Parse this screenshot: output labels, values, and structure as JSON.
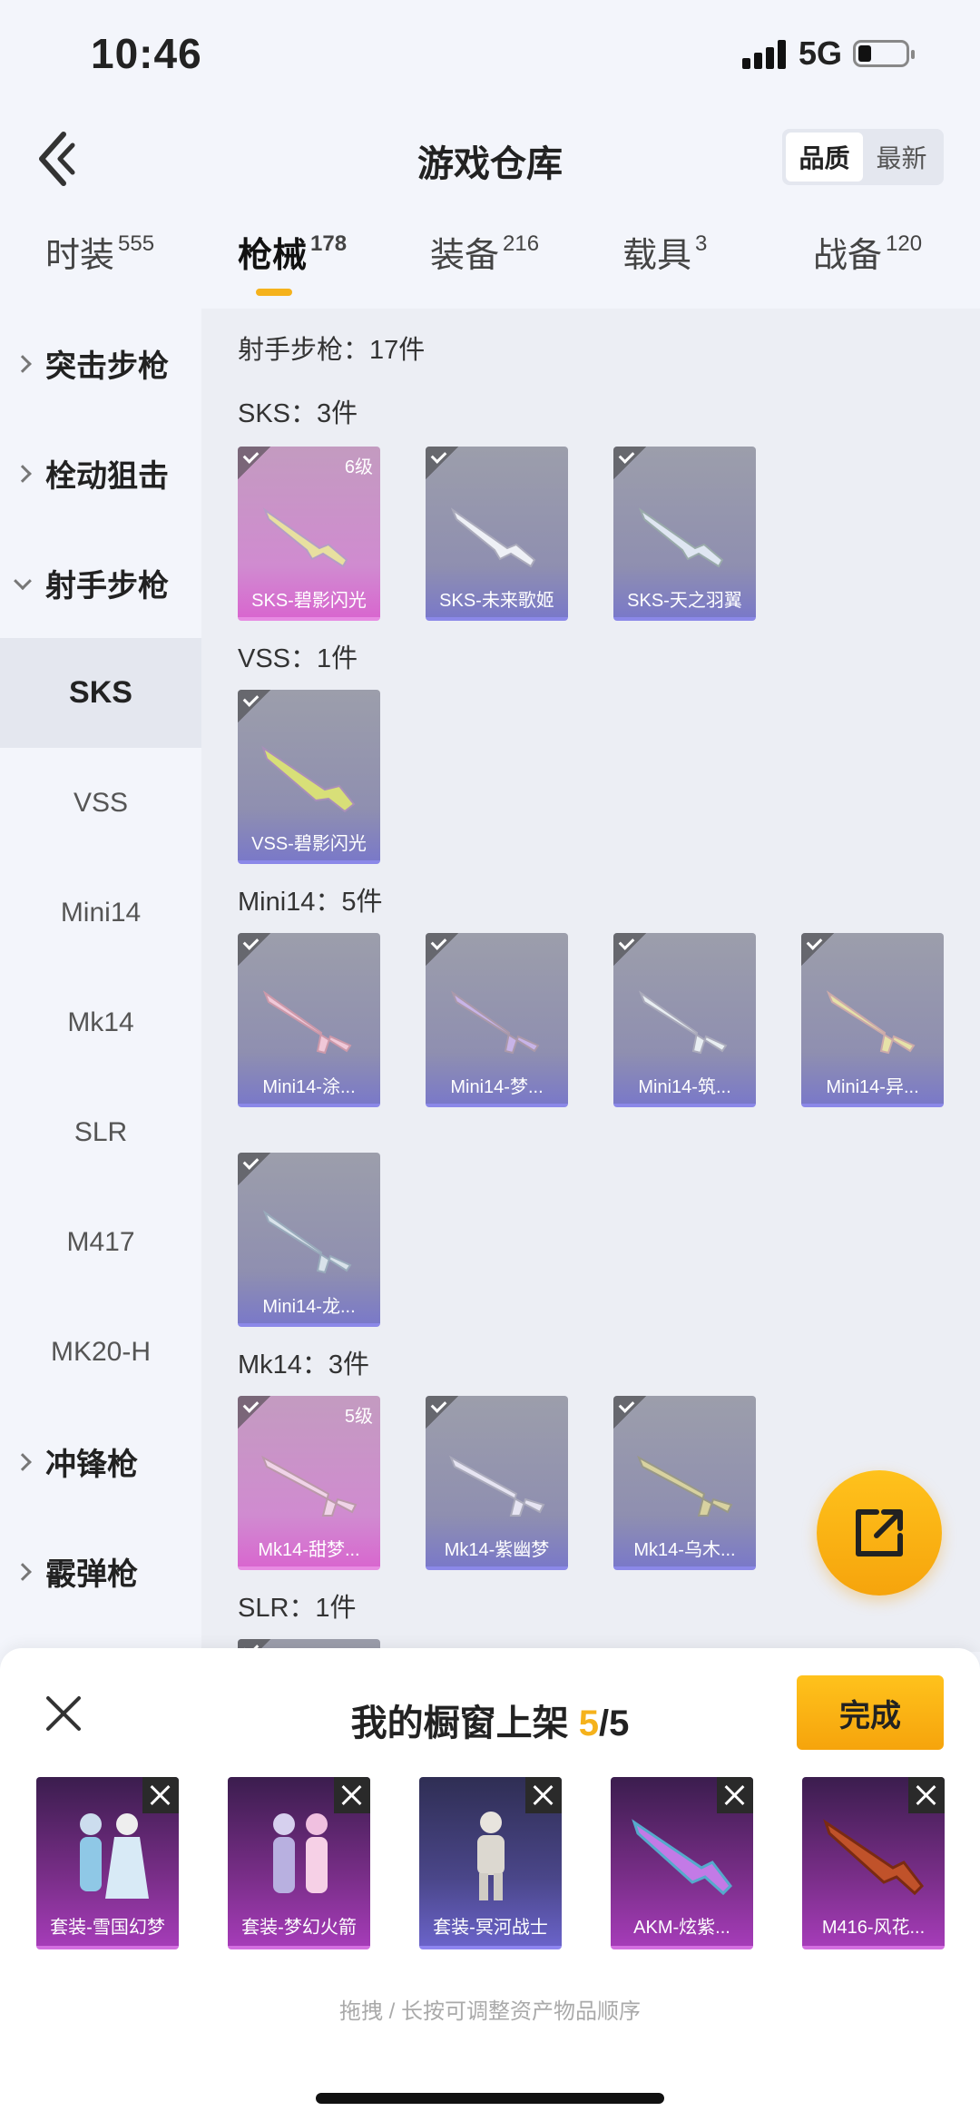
{
  "status": {
    "time": "10:46",
    "network": "5G"
  },
  "header": {
    "title": "游戏仓库",
    "sort": [
      "品质",
      "最新"
    ]
  },
  "tabs": [
    {
      "label": "时装",
      "count": "555"
    },
    {
      "label": "枪械",
      "count": "178"
    },
    {
      "label": "装备",
      "count": "216"
    },
    {
      "label": "载具",
      "count": "3"
    },
    {
      "label": "战备",
      "count": "120"
    }
  ],
  "sidebar": {
    "items": [
      "突击步枪",
      "栓动狙击",
      "射手步枪",
      "SKS",
      "VSS",
      "Mini14",
      "Mk14",
      "SLR",
      "M417",
      "MK20-H",
      "冲锋枪",
      "霰弹枪"
    ]
  },
  "content": {
    "summary": "射手步枪：17件",
    "sections": [
      {
        "title": "SKS：3件",
        "items": [
          "SKS-碧影闪光",
          "SKS-未来歌姬",
          "SKS-天之羽翼"
        ],
        "level": "6级"
      },
      {
        "title": "VSS：1件",
        "items": [
          "VSS-碧影闪光"
        ]
      },
      {
        "title": "Mini14：5件",
        "items": [
          "Mini14-涂...",
          "Mini14-梦...",
          "Mini14-筑...",
          "Mini14-异...",
          "Mini14-龙..."
        ]
      },
      {
        "title": "Mk14：3件",
        "items": [
          "Mk14-甜梦...",
          "Mk14-紫幽梦",
          "Mk14-乌木..."
        ],
        "level": "5级"
      },
      {
        "title": "SLR：1件"
      }
    ]
  },
  "sheet": {
    "title_prefix": "我的橱窗上架 ",
    "count": "5",
    "total": "/5",
    "done": "完成",
    "items": [
      "套装-雪国幻梦",
      "套装-梦幻火箭",
      "套装-冥河战士",
      "AKM-炫紫...",
      "M416-风花..."
    ],
    "hint": "拖拽 / 长按可调整资产物品顺序"
  },
  "colors": {
    "accent": "#f5b21c",
    "pink_card": "#d867cf",
    "purple_card": "#7a79c8"
  }
}
